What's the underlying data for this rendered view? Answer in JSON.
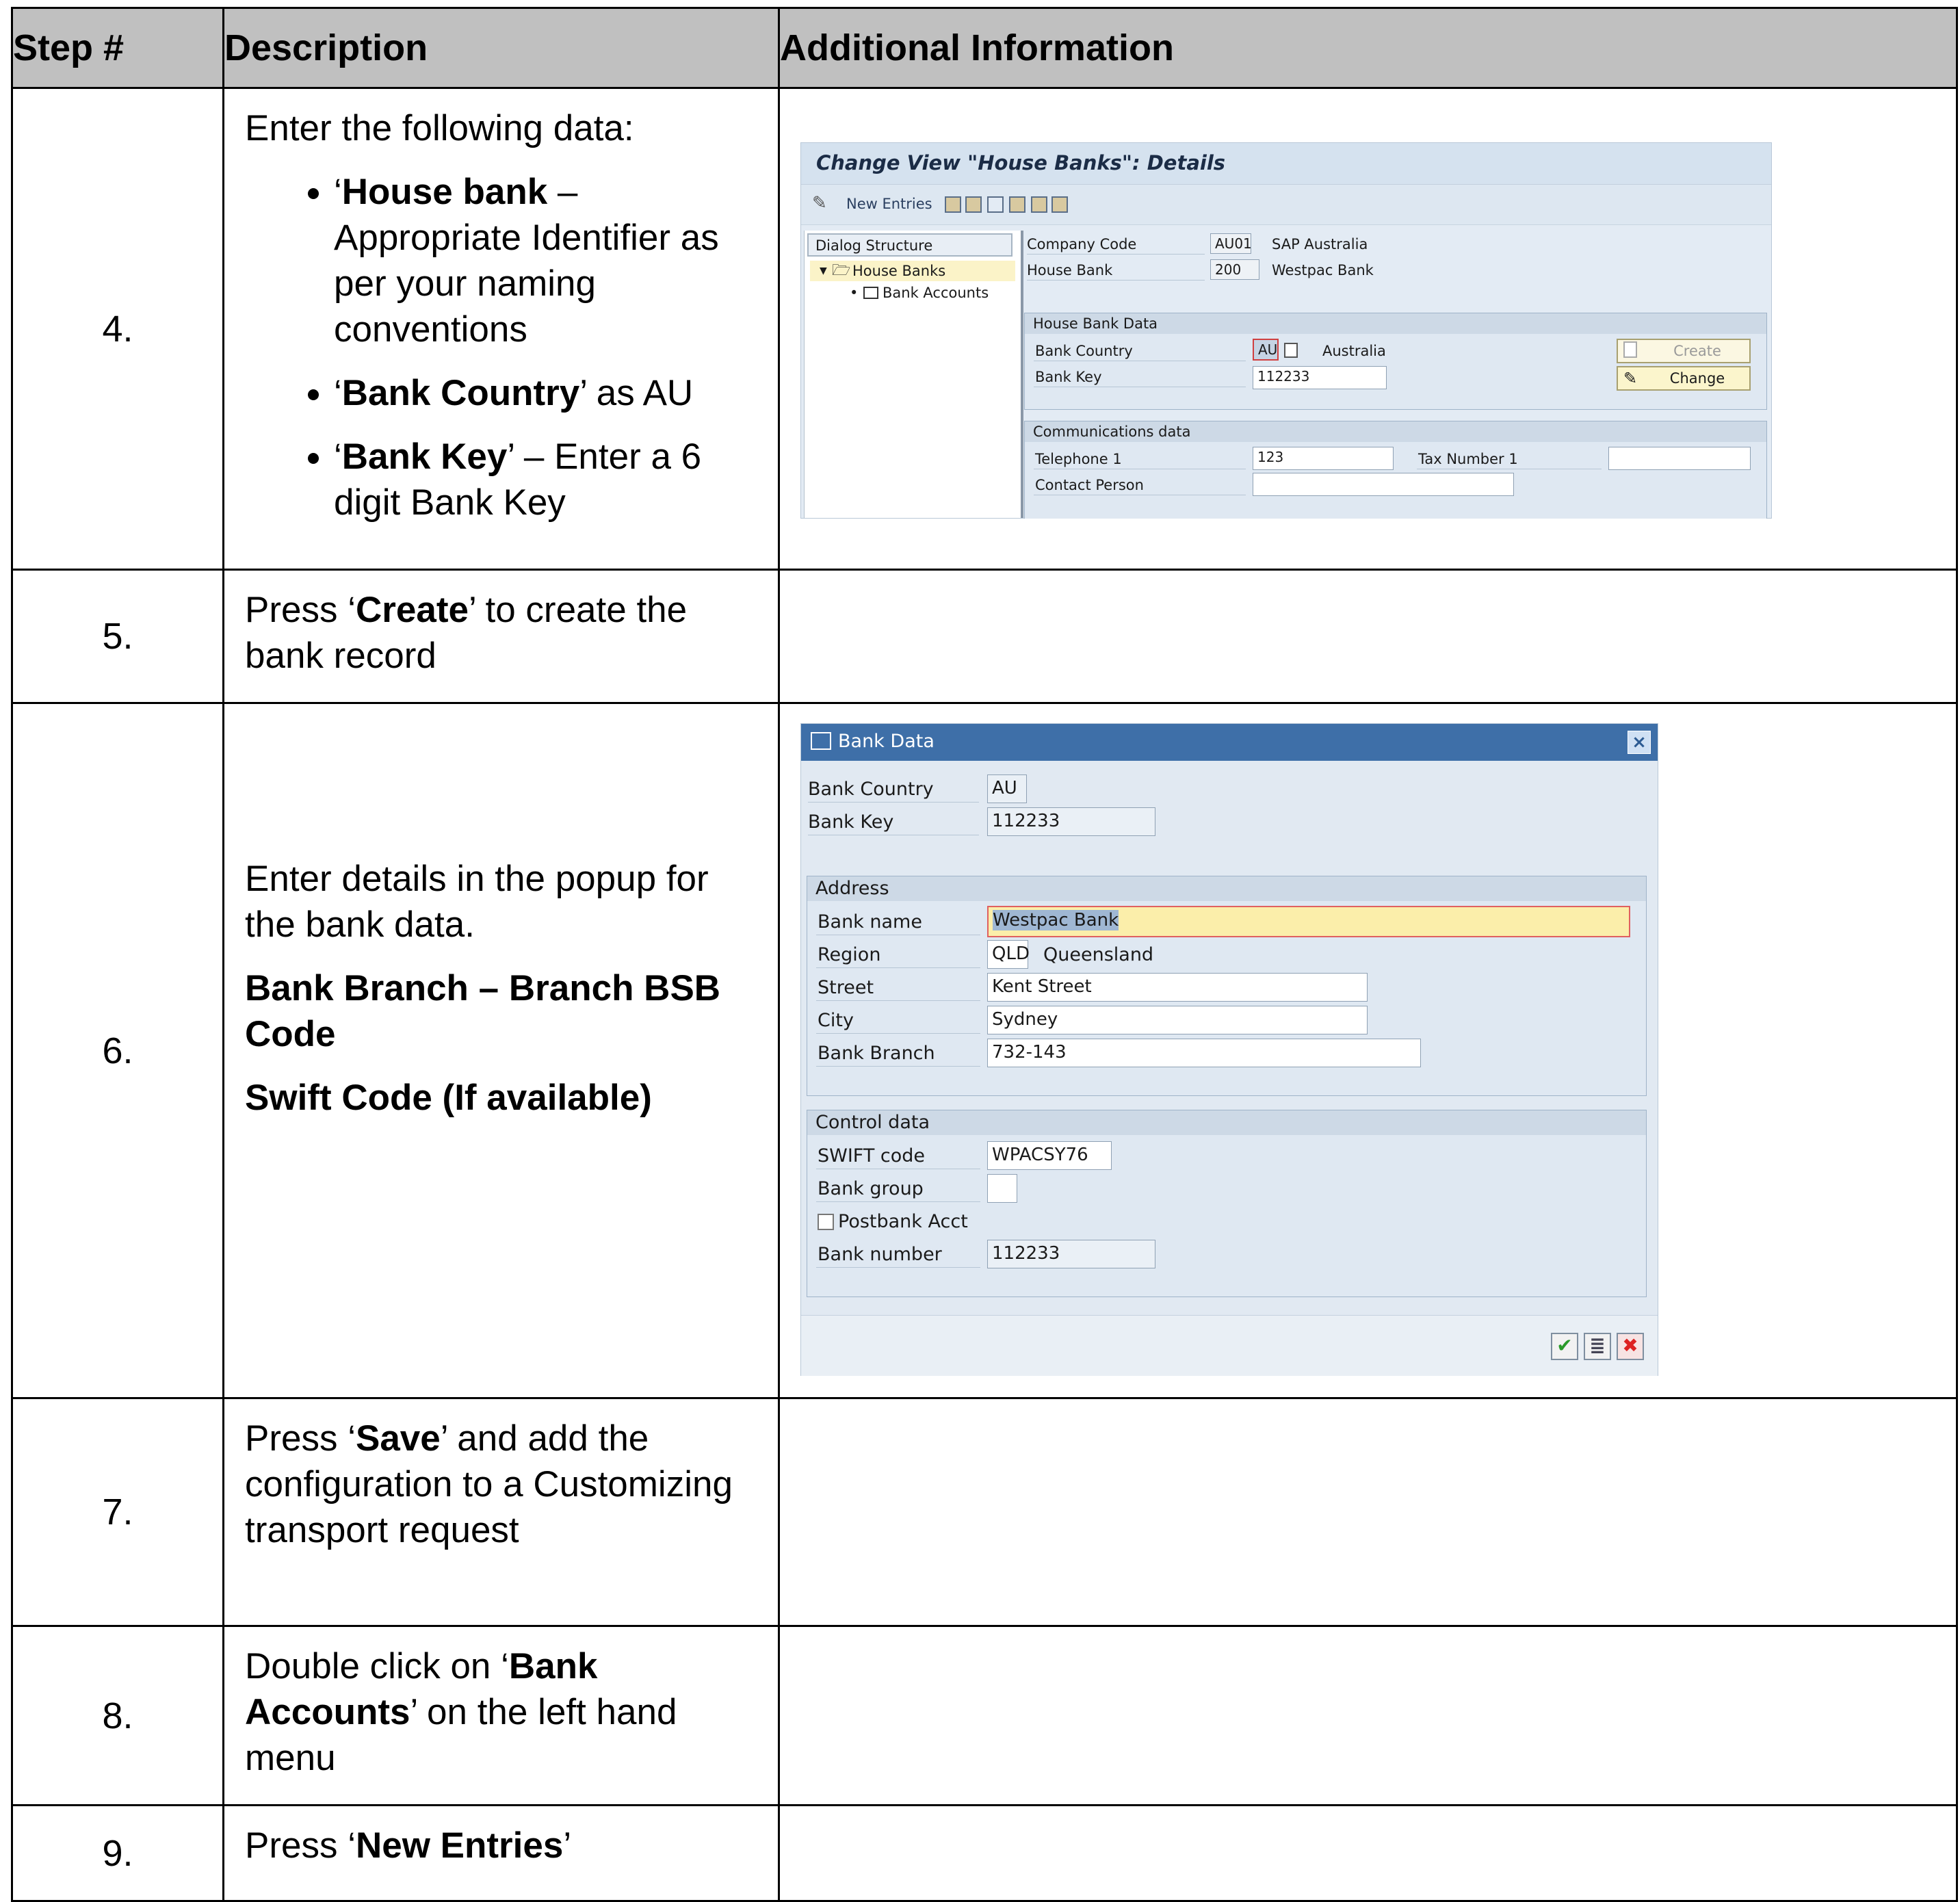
{
  "table": {
    "headers": [
      "Step #",
      "Description",
      "Additional Information"
    ],
    "rows": [
      {
        "num": "4.",
        "intro": "Enter the following data:",
        "bullets": [
          {
            "open": "‘",
            "bold": "House bank",
            "rest": " – Appropriate Identifier as per your naming conventions"
          },
          {
            "open": "‘",
            "bold": "Bank Country",
            "rest": "’ as AU"
          },
          {
            "open": "‘",
            "bold": "Bank Key",
            "rest": "’ – Enter a 6 digit Bank Key"
          }
        ]
      },
      {
        "num": "5.",
        "pre": "Press ‘",
        "bold": "Create",
        "post": "’ to create the bank record"
      },
      {
        "num": "6.",
        "p1": "Enter details in the popup for the bank data.",
        "b1": "Bank Branch – Branch BSB Code",
        "b2": "Swift Code (If available)"
      },
      {
        "num": "7.",
        "pre": "Press ‘",
        "bold": "Save",
        "post": "’ and add the configuration to a Customizing transport request"
      },
      {
        "num": "8.",
        "pre": "Double click on ‘",
        "bold": "Bank Accounts",
        "post": "’ on the left hand menu"
      },
      {
        "num": "9.",
        "pre": "Press ‘",
        "bold": "New Entries",
        "post": "’"
      }
    ]
  },
  "screen1": {
    "title": "Change View \"House Banks\": Details",
    "toolbar_new_entries": "New Entries",
    "dialog_structure": "Dialog Structure",
    "tree_house_banks": "House Banks",
    "tree_bank_accounts": "Bank Accounts",
    "company_code_label": "Company Code",
    "company_code": "AU01",
    "company_name": "SAP Australia",
    "house_bank_label": "House Bank",
    "house_bank": "200",
    "house_bank_name": "Westpac Bank",
    "group_house_bank_data": "House Bank Data",
    "bank_country_label": "Bank Country",
    "bank_country": "AU",
    "country_name": "Australia",
    "bank_key_label": "Bank Key",
    "bank_key": "112233",
    "create_button": "Create",
    "change_button": "Change",
    "group_comm": "Communications data",
    "telephone_label": "Telephone 1",
    "telephone": "123",
    "tax_label": "Tax Number 1",
    "contact_label": "Contact Person"
  },
  "screen2": {
    "title": "Bank Data",
    "bank_country_label": "Bank Country",
    "bank_country": "AU",
    "bank_key_label": "Bank Key",
    "bank_key": "112233",
    "group_address": "Address",
    "bank_name_label": "Bank name",
    "bank_name": "Westpac Bank",
    "region_label": "Region",
    "region": "QLD",
    "region_name": "Queensland",
    "street_label": "Street",
    "street": "Kent Street",
    "city_label": "City",
    "city": "Sydney",
    "branch_label": "Bank Branch",
    "branch": "732-143",
    "group_control": "Control data",
    "swift_label": "SWIFT code",
    "swift": "WPACSY76",
    "bank_group_label": "Bank group",
    "postbank_label": "Postbank Acct",
    "bank_number_label": "Bank number",
    "bank_number": "112233"
  }
}
